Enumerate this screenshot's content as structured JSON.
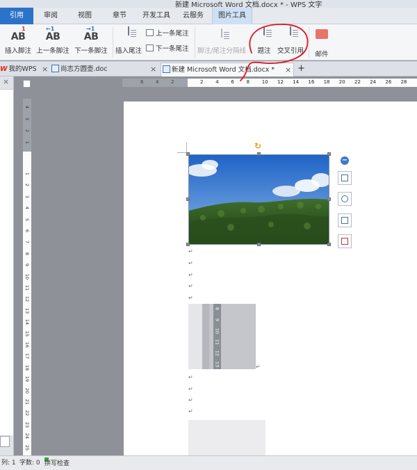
{
  "window": {
    "title": "新建 Microsoft Word 文档.docx * - WPS 文字"
  },
  "ribbon_tabs": [
    {
      "label": "引用",
      "active": true
    },
    {
      "label": "审阅"
    },
    {
      "label": "视图"
    },
    {
      "label": "章节"
    },
    {
      "label": "开发工具"
    },
    {
      "label": "云服务"
    },
    {
      "label": "图片工具",
      "contextual": true
    }
  ],
  "ribbon": {
    "insert_footnote": "插入脚注",
    "prev_footnote": "上一条脚注",
    "next_footnote": "下一条脚注",
    "insert_endnote": "插入尾注",
    "prev_endnote": "上一条尾注",
    "next_endnote": "下一条尾注",
    "separator_line": "脚注/尾注分隔线",
    "caption": "题注",
    "cross_reference": "交叉引用",
    "mail": "邮件",
    "ab": "AB",
    "sup1": "1",
    "arrow_left": "←1",
    "arrow_right": "→1"
  },
  "doc_tabs": [
    {
      "label": "我的WPS",
      "prefix": "W"
    },
    {
      "label": "尚志方圆壶.doc"
    },
    {
      "label": "新建 Microsoft Word 文档.docx *",
      "active": true
    }
  ],
  "doc_tabs_add": "+",
  "close_glyph": "×",
  "hruler": {
    "grey_ticks": [
      "6",
      "4",
      "2"
    ],
    "white_ticks": [
      "2",
      "4",
      "6",
      "8",
      "10",
      "12",
      "14",
      "16",
      "18",
      "20",
      "22",
      "24",
      "26",
      "28"
    ]
  },
  "vruler": {
    "grey_ticks": [
      "4",
      "3",
      "2",
      "1"
    ],
    "white_ticks": [
      "1",
      "2",
      "3",
      "4",
      "5",
      "6",
      "7",
      "8",
      "9",
      "10",
      "11",
      "12",
      "13",
      "14",
      "15",
      "16",
      "17",
      "18",
      "19",
      "20",
      "21",
      "22",
      "23",
      "24",
      "25",
      "26"
    ]
  },
  "image_ruler_ticks": [
    "8",
    "9",
    "10",
    "11",
    "12",
    "13"
  ],
  "paragraph_mark": "↵",
  "rotate_glyph": "↻",
  "minus_glyph": "−",
  "statusbar": {
    "column": "列: 1",
    "words": "字数: 0",
    "spellcheck": "拼写检查"
  },
  "colors": {
    "accent": "#2b73c8",
    "annotation": "#e0141e",
    "rotate": "#f0961e"
  }
}
